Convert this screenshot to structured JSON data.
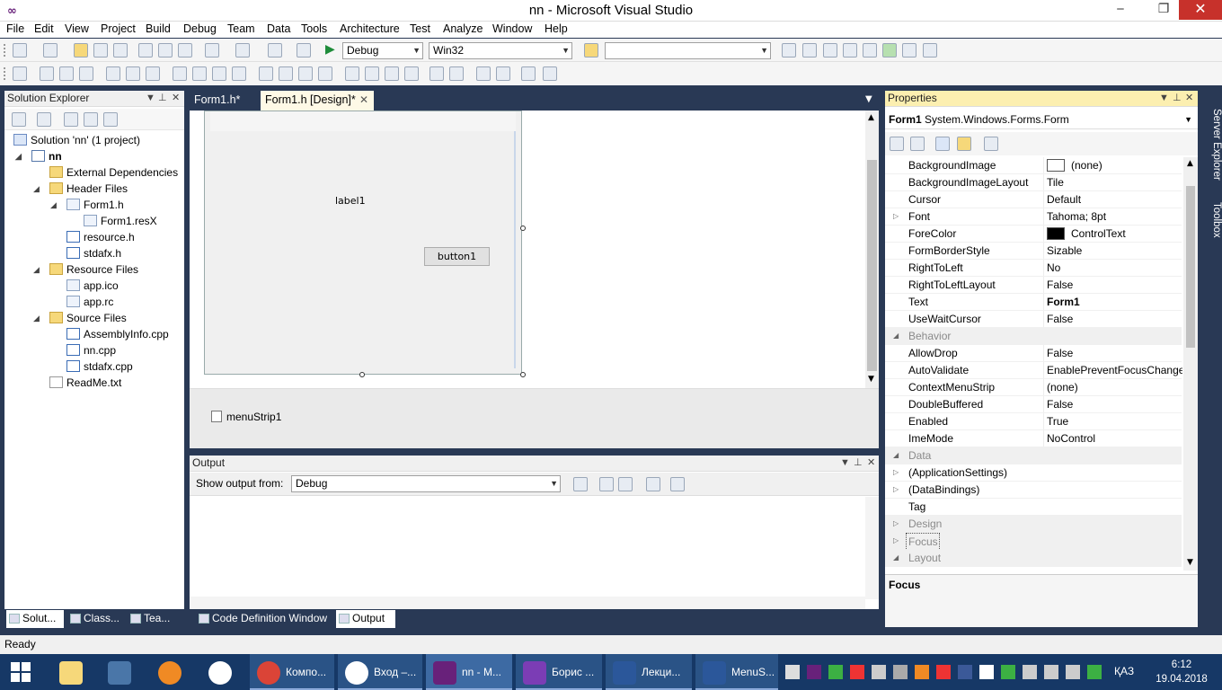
{
  "window": {
    "title": "nn - Microsoft Visual Studio",
    "min": "‒",
    "max": "❐",
    "close": "✕"
  },
  "menu": [
    "File",
    "Edit",
    "View",
    "Project",
    "Build",
    "Debug",
    "Team",
    "Data",
    "Tools",
    "Architecture",
    "Test",
    "Analyze",
    "Window",
    "Help"
  ],
  "toolbar": {
    "config": "Debug",
    "platform": "Win32",
    "find": ""
  },
  "solution_explorer": {
    "title": "Solution Explorer",
    "items": [
      {
        "label": "Solution 'nn' (1 project)",
        "icon": "solution-icon"
      },
      {
        "label": "nn",
        "icon": "project-icon"
      },
      {
        "label": "External Dependencies",
        "icon": "folder-icon"
      },
      {
        "label": "Header Files",
        "icon": "folder-icon"
      },
      {
        "label": "Form1.h",
        "icon": "form-icon"
      },
      {
        "label": "Form1.resX",
        "icon": "resx-icon"
      },
      {
        "label": "resource.h",
        "icon": "header-file-icon"
      },
      {
        "label": "stdafx.h",
        "icon": "header-file-icon"
      },
      {
        "label": "Resource Files",
        "icon": "folder-icon"
      },
      {
        "label": "app.ico",
        "icon": "ico-file-icon"
      },
      {
        "label": "app.rc",
        "icon": "rc-file-icon"
      },
      {
        "label": "Source Files",
        "icon": "folder-icon"
      },
      {
        "label": "AssemblyInfo.cpp",
        "icon": "cpp-file-icon"
      },
      {
        "label": "nn.cpp",
        "icon": "cpp-file-icon"
      },
      {
        "label": "stdafx.cpp",
        "icon": "cpp-file-icon"
      },
      {
        "label": "ReadMe.txt",
        "icon": "text-file-icon"
      }
    ]
  },
  "bottom_tabs": [
    "Solut...",
    "Class...",
    "Tea...",
    "Code Definition Window",
    "Output"
  ],
  "doc_tabs": [
    "Form1.h*",
    "Form1.h [Design]*"
  ],
  "designer": {
    "label1": "label1",
    "button1": "button1",
    "tray_item": "menuStrip1"
  },
  "output": {
    "title": "Output",
    "show_from_label": "Show output from:",
    "source": "Debug"
  },
  "properties": {
    "title": "Properties",
    "object_name": "Form1",
    "object_type": "System.Windows.Forms.Form",
    "rows": [
      {
        "name": "BackgroundImage",
        "value": "(none)"
      },
      {
        "name": "BackgroundImageLayout",
        "value": "Tile"
      },
      {
        "name": "Cursor",
        "value": "Default"
      },
      {
        "name": "Font",
        "value": "Tahoma; 8pt"
      },
      {
        "name": "ForeColor",
        "value": "ControlText"
      },
      {
        "name": "FormBorderStyle",
        "value": "Sizable"
      },
      {
        "name": "RightToLeft",
        "value": "No"
      },
      {
        "name": "RightToLeftLayout",
        "value": "False"
      },
      {
        "name": "Text",
        "value": "Form1"
      },
      {
        "name": "UseWaitCursor",
        "value": "False"
      },
      {
        "name": "Behavior",
        "value": ""
      },
      {
        "name": "AllowDrop",
        "value": "False"
      },
      {
        "name": "AutoValidate",
        "value": "EnablePreventFocusChange"
      },
      {
        "name": "ContextMenuStrip",
        "value": "(none)"
      },
      {
        "name": "DoubleBuffered",
        "value": "False"
      },
      {
        "name": "Enabled",
        "value": "True"
      },
      {
        "name": "ImeMode",
        "value": "NoControl"
      },
      {
        "name": "Data",
        "value": ""
      },
      {
        "name": "(ApplicationSettings)",
        "value": ""
      },
      {
        "name": "(DataBindings)",
        "value": ""
      },
      {
        "name": "Tag",
        "value": ""
      },
      {
        "name": "Design",
        "value": ""
      },
      {
        "name": "Focus",
        "value": ""
      },
      {
        "name": "Layout",
        "value": ""
      }
    ],
    "description_title": "Focus"
  },
  "side_tabs": [
    "Server Explorer",
    "Toolbox"
  ],
  "status": "Ready",
  "taskbar": {
    "apps": [
      "Компо...",
      "Вход –...",
      "nn - M...",
      "Борис ...",
      "Лекци...",
      "MenuS..."
    ],
    "lang": "ҚАЗ",
    "time": "6:12",
    "date": "19.04.2018"
  },
  "colors": {
    "vs_purple": "#68217a",
    "frame": "#293955",
    "taskbar": "#163866",
    "close": "#c7312b"
  }
}
